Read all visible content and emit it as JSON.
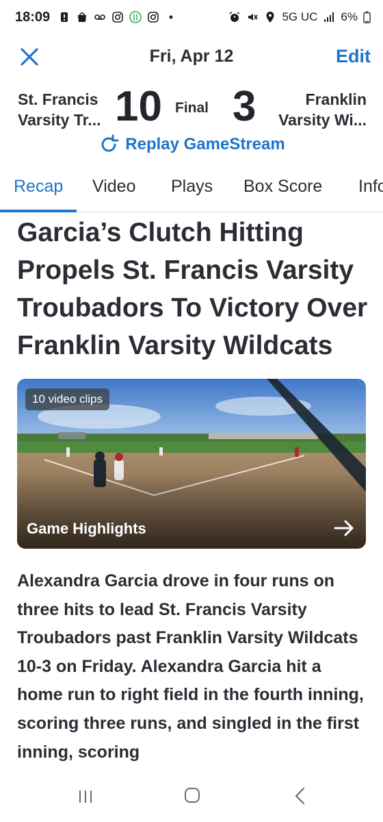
{
  "status_bar": {
    "time": "18:09",
    "network": "5G UC",
    "battery": "6%",
    "icons_left": [
      "alert-icon",
      "bag-icon",
      "voicemail-icon",
      "instagram-icon",
      "food-icon",
      "instagram-icon",
      "dot-icon"
    ],
    "icons_right": [
      "alarm-icon",
      "mute-icon",
      "location-icon",
      "signal-icon",
      "battery-icon"
    ]
  },
  "header": {
    "close_icon": "close-icon",
    "date": "Fri, Apr 12",
    "edit_label": "Edit"
  },
  "scoreboard": {
    "home_team_line1": "St. Francis",
    "home_team_line2": "Varsity Tr...",
    "home_score": "10",
    "status": "Final",
    "away_score": "3",
    "away_team_line1": "Franklin",
    "away_team_line2": "Varsity Wi..."
  },
  "replay": {
    "icon": "refresh-icon",
    "label": "Replay GameStream"
  },
  "tabs": [
    {
      "label": "Recap",
      "active": true
    },
    {
      "label": "Video",
      "active": false
    },
    {
      "label": "Plays",
      "active": false
    },
    {
      "label": "Box Score",
      "active": false
    },
    {
      "label": "Info",
      "active": false
    }
  ],
  "article": {
    "headline": "Garcia’s Clutch Hitting Propels St. Francis Varsity Troubadors To Victory Over Franklin Varsity Wildcats",
    "video": {
      "badge": "10 video clips",
      "title": "Game Highlights",
      "arrow_icon": "arrow-right-icon"
    },
    "body": "Alexandra Garcia drove in four runs on three hits to lead St. Francis Varsity Troubadors past Franklin Varsity Wildcats 10-3 on Friday. Alexandra Garcia hit a home run to right field in the fourth inning, scoring three runs, and singled in the first inning, scoring"
  },
  "colors": {
    "accent": "#1f74c9",
    "text": "#2a2d34",
    "divider": "#dcdfe4"
  },
  "nav_bar": {
    "recents_icon": "recents-icon",
    "home_icon": "home-icon",
    "back_icon": "back-icon"
  }
}
